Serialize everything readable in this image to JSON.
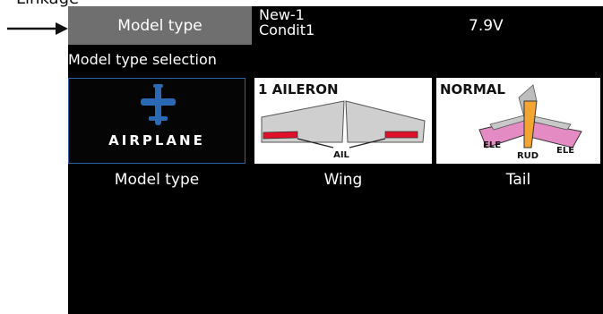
{
  "callout": {
    "label": "Linkage"
  },
  "header": {
    "title": "Model type",
    "model_name": "New-1",
    "condition": "Condit1",
    "voltage": "7.9V"
  },
  "subtitle": "Model type selection",
  "options": [
    {
      "caption": "Model type",
      "value": "AIRPLANE"
    },
    {
      "caption": "Wing",
      "value": "1 AILERON",
      "labels": [
        "AIL"
      ]
    },
    {
      "caption": "Tail",
      "value": "NORMAL",
      "labels": [
        "ELE",
        "RUD",
        "ELE"
      ]
    }
  ],
  "colors": {
    "screen_bg": "#000000",
    "title_tab_bg": "#6f6f6f",
    "airplane_icon": "#2a6ab4",
    "aileron_red": "#e0102a",
    "rudder_orange": "#f2a531",
    "elevator_pink": "#e48bc4"
  }
}
